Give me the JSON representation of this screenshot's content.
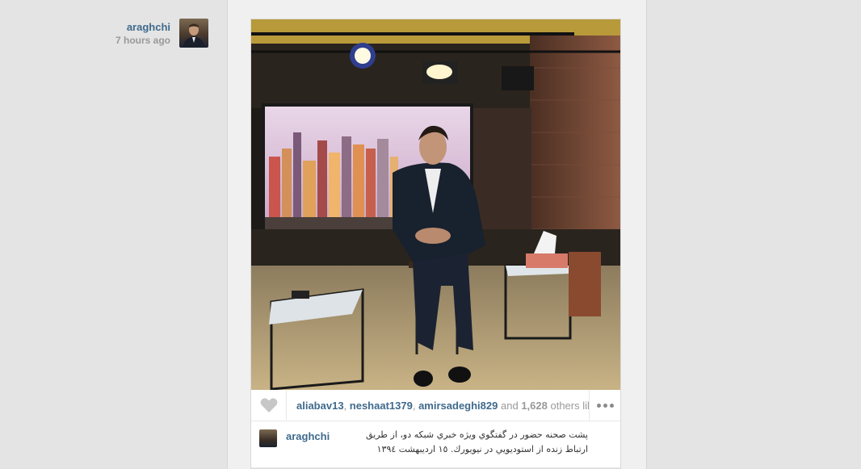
{
  "post": {
    "author": "araghchi",
    "time_ago": "7 hours ago",
    "likes": {
      "users": [
        "aliabav13",
        "neshaat1379",
        "amirsadeghi829"
      ],
      "and_text": "and",
      "count": "1,628",
      "others_text": "others lik..."
    },
    "caption_user": "araghchi",
    "caption_text": "پشت صحنه حضور در گفتگوي ويژه خبري شبكه دو، از طريق ارتباط زنده از استوديويي در نيويورك. ١٥ ارديبهشت ١٣٩٤"
  },
  "icons": {
    "like": "heart-icon",
    "more": "more-options-icon"
  },
  "colors": {
    "username": "#3f6a8c",
    "muted": "#999999",
    "background": "#e4e4e4"
  }
}
